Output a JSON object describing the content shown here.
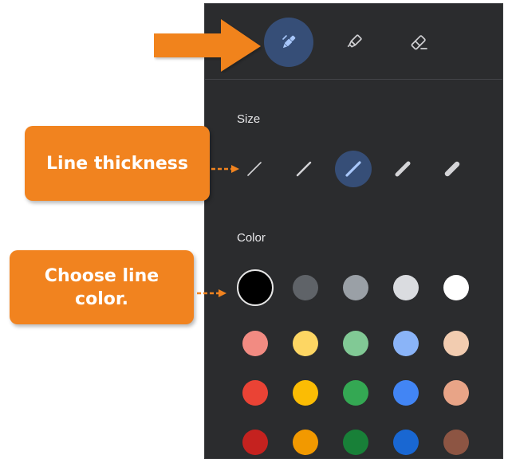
{
  "annotations": {
    "line_thickness": "Line thickness",
    "choose_color": "Choose line color."
  },
  "toolbar": {
    "tools": [
      {
        "id": "pen",
        "icon": "pen-icon",
        "selected": true
      },
      {
        "id": "highlighter",
        "icon": "highlighter-icon",
        "selected": false
      },
      {
        "id": "eraser",
        "icon": "eraser-icon",
        "selected": false
      }
    ]
  },
  "size": {
    "label": "Size",
    "options": [
      {
        "level": 1,
        "selected": false
      },
      {
        "level": 2,
        "selected": false
      },
      {
        "level": 3,
        "selected": true
      },
      {
        "level": 4,
        "selected": false
      },
      {
        "level": 5,
        "selected": false
      }
    ]
  },
  "color": {
    "label": "Color",
    "rows": [
      [
        "#000000",
        "#5f6368",
        "#9aa0a6",
        "#dadce0",
        "#ffffff"
      ],
      [
        "#f28b82",
        "#fdd663",
        "#81c995",
        "#8ab4f8",
        "#f2ccb0"
      ],
      [
        "#ea4335",
        "#fbbc04",
        "#34a853",
        "#4285f4",
        "#e8a487"
      ],
      [
        "#c5221f",
        "#f29900",
        "#188038",
        "#1967d2",
        "#8d5543"
      ]
    ],
    "selected": "#000000"
  },
  "theme": {
    "panel_bg": "#2b2c2e",
    "selected_bg": "#364e77",
    "accent": "#a8c7fa",
    "annotation": "#f1831f"
  }
}
